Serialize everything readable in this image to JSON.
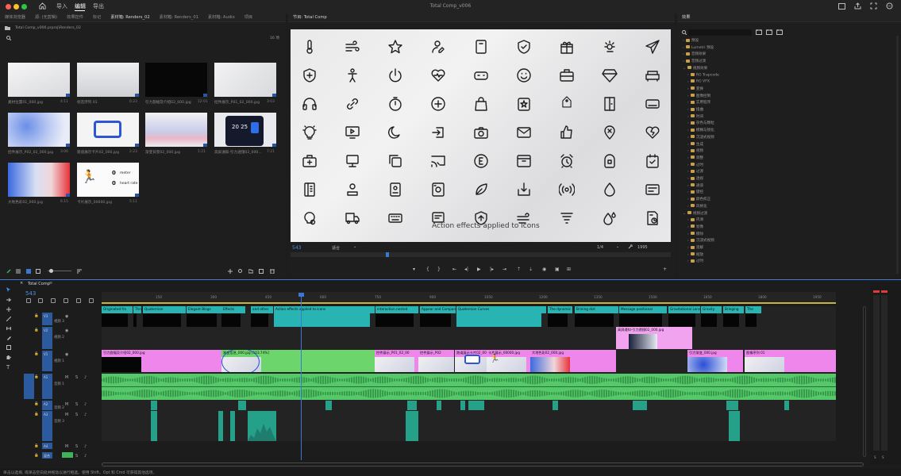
{
  "app": {
    "title": "Total Comp_v006"
  },
  "nav": [
    "导入",
    "编辑",
    "导出"
  ],
  "nav_active": 1,
  "source_tabs": [
    "媒体浏览器",
    "源: (无剪辑)",
    "效果控件",
    "标记",
    "素材箱: Renders_02",
    "素材箱: Renders_01",
    "素材箱: Audio",
    "项目"
  ],
  "source_active": 4,
  "bin": {
    "path": "Total Comp_v006.prproj\\Renders_02",
    "count": "16 项"
  },
  "thumbs": [
    {
      "name": "素材位置01_000.jpg",
      "dur": "4:11",
      "style": "gw"
    },
    {
      "name": "标签序列 01",
      "dur": "6:23",
      "style": "gw2"
    },
    {
      "name": "引力旋幅及介绍02_000.jpg",
      "dur": "12:01",
      "style": "black"
    },
    {
      "name": "控件展示_P01_02_000.jpg",
      "dur": "3:03",
      "style": "gw3"
    },
    {
      "name": "控件展示_P02_02_000.jpg",
      "dur": "3:06",
      "style": "blue"
    },
    {
      "name": "跑道展示卡片02_000.jpg",
      "dur": "2:23",
      "style": "frame"
    },
    {
      "name": "渐变背景02_000.jpg",
      "dur": "1:21",
      "style": "bluepink"
    },
    {
      "name": "高屏通知-引力透镜02_000...",
      "dur": "7:21",
      "style": "phone"
    },
    {
      "name": "大地色彩02_000.jpg",
      "dur": "6:15",
      "style": "redblue"
    },
    {
      "name": "卡片展示_00000.jpg",
      "dur": "5:11",
      "style": "sport"
    }
  ],
  "sport_card": {
    "v1": "0",
    "l1": "meter",
    "v2": "0",
    "l2": "heart rate"
  },
  "phone_time": "20 25",
  "program": {
    "tab": "节目: Total Comp",
    "timecode": "543",
    "fit": "适合",
    "scale": "1/4",
    "duration": "1995",
    "overlay": "Action effects applied to icons"
  },
  "icons": [
    "thermometer",
    "wind",
    "star",
    "user-edit",
    "book",
    "shield-check",
    "gift",
    "sun-cloud",
    "send",
    "shield-plus",
    "person",
    "power",
    "heart-pulse",
    "gamepad",
    "smile",
    "briefcase",
    "diamond",
    "sofa",
    "headphones",
    "link",
    "timer",
    "plus-circle",
    "bag",
    "star-badge",
    "tag",
    "door",
    "ticket",
    "bulb",
    "play-monitor",
    "moon",
    "sign-in",
    "camera",
    "mail",
    "thumb-up",
    "pin-x",
    "heart-broken",
    "first-aid",
    "monitor-stand",
    "copy",
    "cast",
    "disc-e",
    "archive",
    "alarm",
    "lock-badge",
    "calendar-check",
    "book-list",
    "user-badge",
    "id-card",
    "safe",
    "leaf",
    "download-box",
    "radio",
    "drop",
    "message",
    "bulb-gear",
    "truck",
    "keyboard",
    "pin-text",
    "shield-up",
    "wind-2",
    "tornado",
    "drops",
    "doc-clock"
  ],
  "effects_tab": "效果",
  "effects": [
    {
      "t": "预设",
      "lvl": 0
    },
    {
      "t": "Lumetri 预设",
      "lvl": 0
    },
    {
      "t": "音频效果",
      "lvl": 0
    },
    {
      "t": "音频过渡",
      "lvl": 0
    },
    {
      "t": "视频效果",
      "lvl": 0,
      "open": true
    },
    {
      "t": "RG Trapcode",
      "lvl": 1
    },
    {
      "t": "RG VFX",
      "lvl": 1
    },
    {
      "t": "变换",
      "lvl": 1
    },
    {
      "t": "图像控制",
      "lvl": 1
    },
    {
      "t": "实用程序",
      "lvl": 1
    },
    {
      "t": "扭曲",
      "lvl": 1
    },
    {
      "t": "时间",
      "lvl": 1
    },
    {
      "t": "杂色与颗粒",
      "lvl": 1
    },
    {
      "t": "模糊与锐化",
      "lvl": 1
    },
    {
      "t": "沉浸式视频",
      "lvl": 1
    },
    {
      "t": "生成",
      "lvl": 1
    },
    {
      "t": "视频",
      "lvl": 1
    },
    {
      "t": "调整",
      "lvl": 1
    },
    {
      "t": "过时",
      "lvl": 1
    },
    {
      "t": "过渡",
      "lvl": 1
    },
    {
      "t": "透视",
      "lvl": 1
    },
    {
      "t": "通道",
      "lvl": 1
    },
    {
      "t": "键控",
      "lvl": 1
    },
    {
      "t": "颜色校正",
      "lvl": 1
    },
    {
      "t": "风格化",
      "lvl": 1
    },
    {
      "t": "视频过渡",
      "lvl": 0,
      "open": true
    },
    {
      "t": "内滑",
      "lvl": 1
    },
    {
      "t": "划像",
      "lvl": 1
    },
    {
      "t": "擦除",
      "lvl": 1
    },
    {
      "t": "沉浸式视频",
      "lvl": 1
    },
    {
      "t": "溶解",
      "lvl": 1
    },
    {
      "t": "缩放",
      "lvl": 1
    },
    {
      "t": "过时",
      "lvl": 1
    }
  ],
  "timeline": {
    "tab": "Total Comp",
    "timecode": "543",
    "ticks": [
      "150",
      "300",
      "450",
      "600",
      "750",
      "900",
      "1050",
      "1200",
      "1350",
      "1500",
      "1650",
      "1800",
      "1950"
    ],
    "tracks": [
      "V3",
      "V2",
      "V1",
      "A1",
      "A2",
      "A3",
      "A4",
      "混合"
    ],
    "track_names": [
      "视频 3",
      "视频 2",
      "视频 1",
      "音频 1",
      "音频 2",
      "音频 3"
    ],
    "v3_clips": [
      "Originated fro",
      "Thre",
      "Quaternion",
      "Elegant Blogs",
      "Effects",
      "and other",
      "Action effects applied to icons",
      "interaction.nested",
      "Appear and Component",
      "Quaternion Curves",
      "The dynamic",
      "Brining dist",
      "Message positional",
      "Gravitational Lenses",
      "Gravity",
      "Bringing",
      "The"
    ],
    "v2_clips": [
      "高屏通知-引力透镜02_000.jpg"
    ],
    "v1_clips": [
      "引力旋幅及介绍02_000.jpg",
      "渐变信息_000.jpg [103.74%]",
      "控件展示_P01_02_00",
      "控件展示_P02",
      "跑道展示卡片02_000",
      "卡片展示_00000.jpg",
      "大地色彩02_000.jpg",
      "引力渐变_000.jpg",
      "图像序列 01"
    ]
  },
  "status": "单击以选择, 或单击空白处并拖动以进行框选。使用 Shift、Opt 和 Cmd 可获得其他选项。",
  "colors": {
    "v3": "#28b4b2",
    "v1": "#ee86ec",
    "v1green": "#6cd66c",
    "audio": "#55c96a",
    "audio_dark": "#2e8a40",
    "a2": "#25a089",
    "blue": "#3a78d6"
  }
}
